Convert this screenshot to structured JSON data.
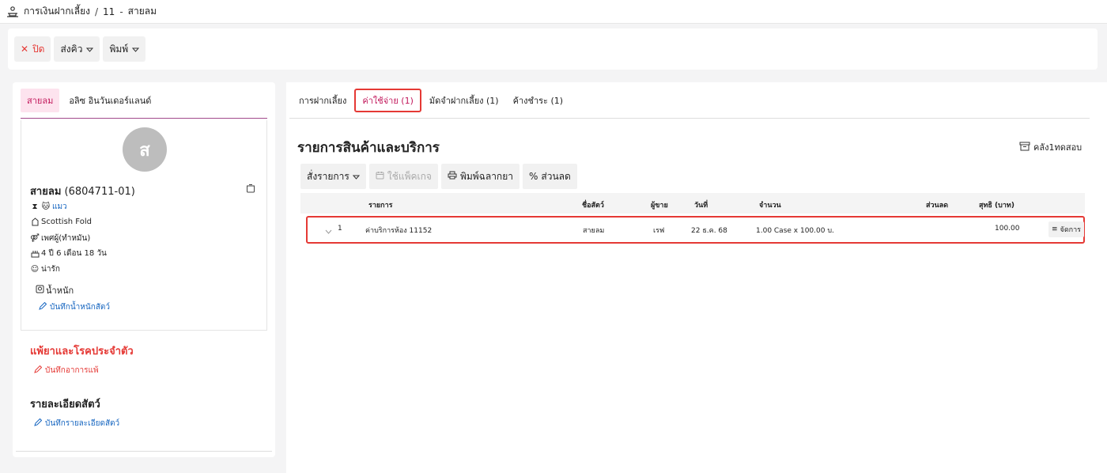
{
  "breadcrumb": {
    "section": "การเงินฝากเลี้ยง",
    "sep": "/",
    "id": "11",
    "dash": "-",
    "name": "สายลม"
  },
  "toolbar": {
    "close_label": "ปิด",
    "queue_label": "ส่งคิว",
    "print_label": "พิมพ์"
  },
  "left": {
    "tabs": [
      "สายลม",
      "อลิซ อินวันเดอร์แลนด์"
    ],
    "avatar_letter": "ส",
    "pet_name": "สายลม",
    "pet_code": "(6804711-01)",
    "species": "แมว",
    "breed": "Scottish Fold",
    "sex": "เพศผู้(ทำหมัน)",
    "age": "4 ปี 6 เดือน 18 วัน",
    "temperament": "น่ารัก",
    "weight_label": "น้ำหนัก",
    "weight_link": "บันทึกน้ำหนักสัตว์",
    "allergy_title": "แพ้ยาและโรคประจำตัว",
    "allergy_link": "บันทึกอาการแพ้",
    "detail_title": "รายละเอียดสัตว์",
    "detail_link": "บันทึกรายละเอียดสัตว์"
  },
  "right": {
    "tabs": [
      "การฝากเลี้ยง",
      "ค่าใช้จ่าย (1)",
      "มัดจำฝากเลี้ยง (1)",
      "ค้างชำระ (1)"
    ],
    "title": "รายการสินค้าและบริการ",
    "archive_label": "คลัง1ทดสอบ",
    "actions": {
      "order": "สั่งรายการ",
      "package": "ใช้แพ็คเกจ",
      "print_label": "พิมพ์ฉลากยา",
      "discount": "ส่วนลด"
    },
    "columns": [
      "รายการ",
      "ชื่อสัตว์",
      "ผู้ขาย",
      "วันที่",
      "จำนวน",
      "ส่วนลด",
      "สุทธิ (บาท)"
    ],
    "rows": [
      {
        "no": "1",
        "item": "ค่าบริการห้อง 11152",
        "pet": "สายลม",
        "seller": "เรฟ",
        "date": "22 ธ.ค. 68",
        "qty": "1.00 Case x 100.00 บ.",
        "discount": "",
        "net": "100.00",
        "manage": "จัดการ"
      }
    ]
  }
}
